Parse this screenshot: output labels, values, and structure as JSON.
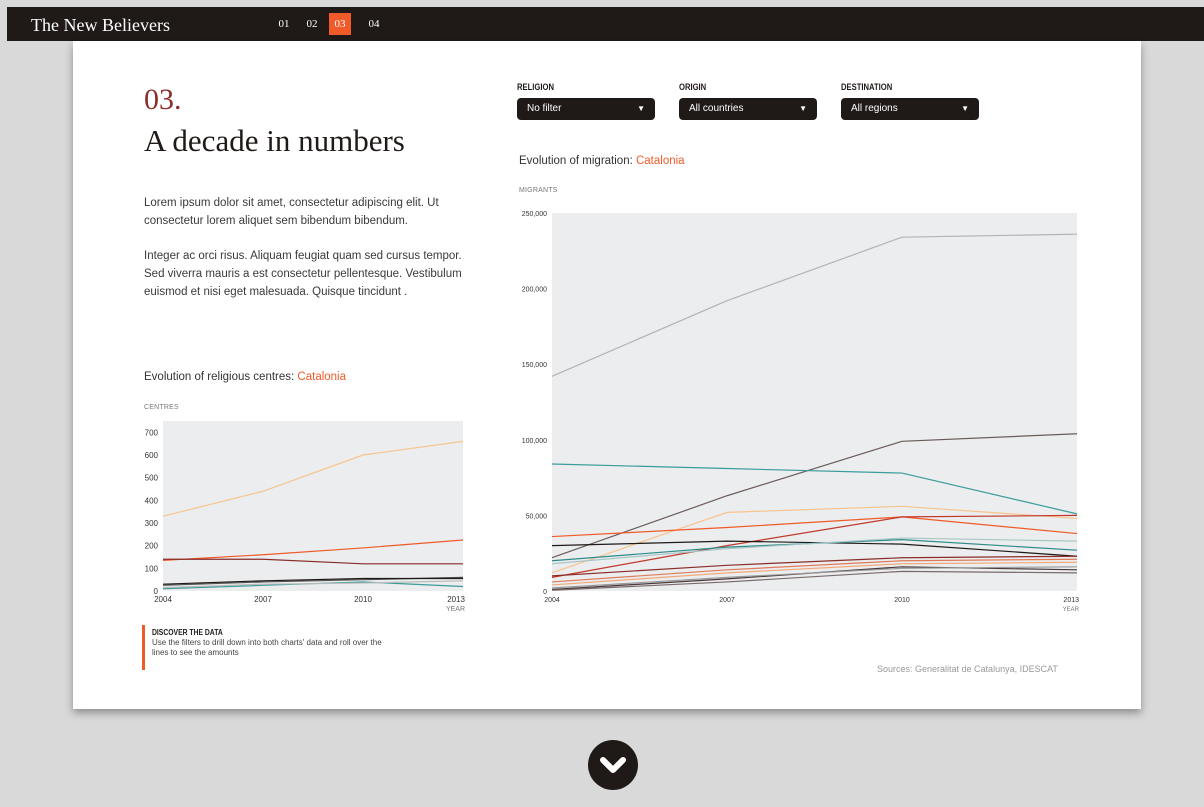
{
  "header": {
    "title": "The New Believers",
    "nav": [
      "01",
      "02",
      "03",
      "04"
    ],
    "active_index": 2
  },
  "section": {
    "number": "03.",
    "title": "A decade in numbers",
    "paragraph1": " Lorem ipsum dolor sit amet, consectetur adipiscing elit. Ut consectetur lorem aliquet sem bibendum bibendum.",
    "paragraph2": "Integer ac orci risus. Aliquam feugiat quam sed cursus tempor. Sed viverra mauris a est consectetur pellentesque. Vestibulum euismod et nisi eget malesuada. Quisque tincidunt ."
  },
  "filters": [
    {
      "label": "RELIGION",
      "value": "No filter"
    },
    {
      "label": "ORIGIN",
      "value": "All countries"
    },
    {
      "label": "DESTINATION",
      "value": "All regions"
    }
  ],
  "left_chart_heading": {
    "prefix": "Evolution of religious centres: ",
    "highlight": "Catalonia"
  },
  "right_chart_heading": {
    "prefix": "Evolution of migration: ",
    "highlight": "Catalonia"
  },
  "discover": {
    "title": "DISCOVER THE DATA",
    "text": "Use the filters to drill down into both charts' data and roll over the lines to see the amounts"
  },
  "sources": "Sources: Generalitat de Catalunya, IDESCAT",
  "icons": {
    "scroll": "chevron-down-icon",
    "select_caret": "triangle-down-icon"
  },
  "colors": {
    "accent": "#f05a28",
    "dark": "#1f1a18",
    "title_red": "#8b2d2a",
    "plot_bg": "#ebedee"
  },
  "chart_data": [
    {
      "type": "line",
      "ylabel": "CENTRES",
      "xlabel": "YEAR",
      "x": [
        2004,
        2007,
        2010,
        2013
      ],
      "x_ticks": [
        "2004",
        "2007",
        "2010",
        "2013"
      ],
      "ylim": [
        0,
        750
      ],
      "y_ticks": [
        0,
        100,
        200,
        300,
        400,
        500,
        600,
        700
      ],
      "y_tick_labels": [
        "0",
        "100",
        "200",
        "300",
        "400",
        "500",
        "600",
        "700"
      ],
      "series": [
        {
          "color": "#f8c48e",
          "values": [
            330,
            440,
            600,
            660
          ]
        },
        {
          "color": "#f05a28",
          "values": [
            135,
            160,
            190,
            225
          ]
        },
        {
          "color": "#8b2d2a",
          "values": [
            140,
            140,
            120,
            120
          ]
        },
        {
          "color": "#555555",
          "values": [
            25,
            40,
            50,
            60
          ]
        },
        {
          "color": "#1f1a18",
          "values": [
            30,
            45,
            55,
            55
          ]
        },
        {
          "color": "#3a9c9b",
          "values": [
            10,
            25,
            40,
            20
          ]
        },
        {
          "color": "#bbbbbb",
          "values": [
            15,
            30,
            35,
            45
          ]
        }
      ]
    },
    {
      "type": "line",
      "ylabel": "MIGRANTS",
      "xlabel": "YEAR",
      "x": [
        2004,
        2007,
        2010,
        2013
      ],
      "x_ticks": [
        "2004",
        "2007",
        "2010",
        "2013"
      ],
      "ylim": [
        0,
        250000
      ],
      "y_ticks": [
        0,
        50000,
        100000,
        150000,
        200000,
        250000
      ],
      "y_tick_labels": [
        "0",
        "50,000",
        "100,000",
        "150,000",
        "200,000",
        "250,000"
      ],
      "series": [
        {
          "color": "#b3b3b3",
          "values": [
            142000,
            192000,
            234000,
            236000
          ]
        },
        {
          "color": "#6b5b5b",
          "values": [
            22000,
            63000,
            99000,
            104000
          ]
        },
        {
          "color": "#3a9c9b",
          "values": [
            84000,
            81000,
            78000,
            51000
          ]
        },
        {
          "color": "#f8c48e",
          "values": [
            12000,
            52000,
            56000,
            48000
          ]
        },
        {
          "color": "#f05a28",
          "values": [
            36000,
            42000,
            49000,
            38000
          ]
        },
        {
          "color": "#c0392b",
          "values": [
            9000,
            30000,
            49000,
            50000
          ]
        },
        {
          "color": "#1f1a18",
          "values": [
            30000,
            33000,
            31000,
            23000
          ]
        },
        {
          "color": "#2e8b8b",
          "values": [
            20000,
            29000,
            34000,
            27000
          ]
        },
        {
          "color": "#a8c6c6",
          "values": [
            18000,
            28000,
            35000,
            33000
          ]
        },
        {
          "color": "#8b2d2a",
          "values": [
            10000,
            17000,
            22000,
            23000
          ]
        },
        {
          "color": "#e07b5a",
          "values": [
            6000,
            14000,
            20000,
            21000
          ]
        },
        {
          "color": "#f2a97a",
          "values": [
            4000,
            12000,
            18000,
            19000
          ]
        },
        {
          "color": "#4a3a3a",
          "values": [
            1000,
            8000,
            16000,
            14000
          ]
        },
        {
          "color": "#7a6a6a",
          "values": [
            500,
            6000,
            13000,
            12000
          ]
        },
        {
          "color": "#999999",
          "values": [
            2000,
            9000,
            15000,
            16000
          ]
        }
      ]
    }
  ]
}
